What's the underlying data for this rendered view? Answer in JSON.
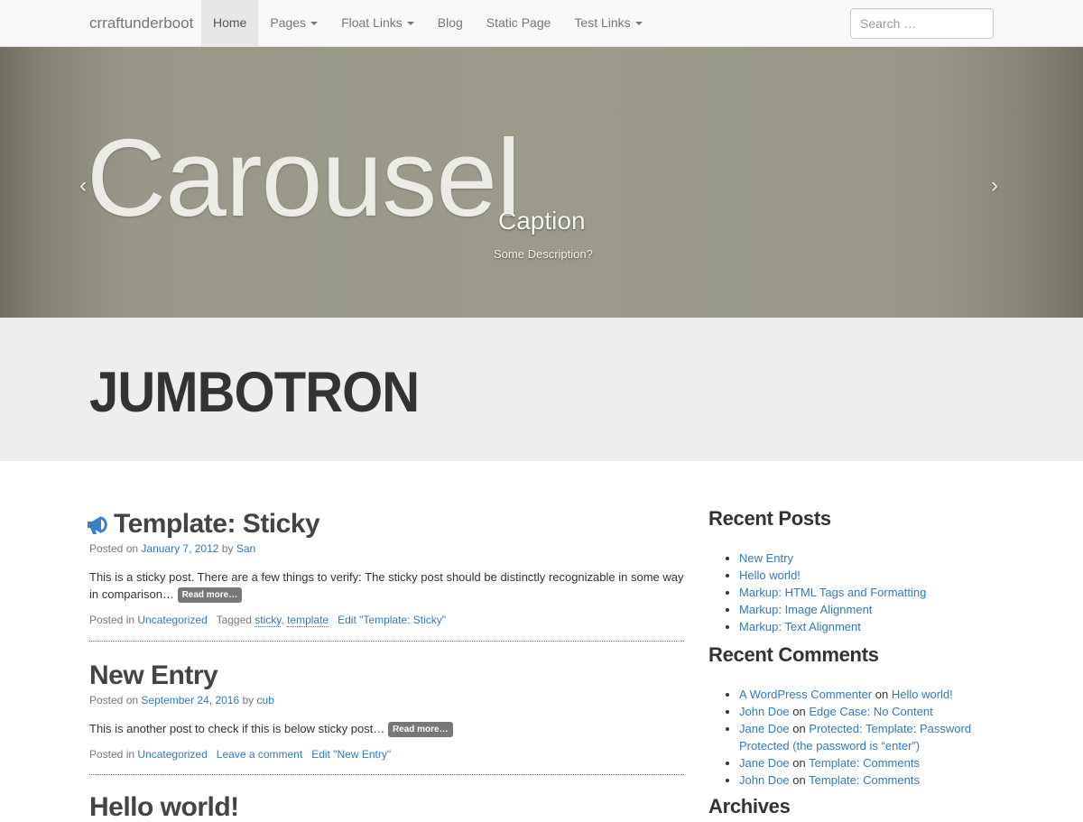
{
  "navbar": {
    "brand": "crraftunderboot",
    "items": [
      {
        "label": "Home"
      },
      {
        "label": "Pages"
      },
      {
        "label": "Float Links"
      },
      {
        "label": "Blog"
      },
      {
        "label": "Static Page"
      },
      {
        "label": "Test Links"
      }
    ],
    "search_placeholder": "Search …"
  },
  "carousel": {
    "title": "Carousel",
    "caption": "Caption",
    "description": "Some Description?",
    "prev_icon": "chevron-left-icon",
    "next_icon": "chevron-right-icon"
  },
  "jumbotron": {
    "title": "JUMBOTRON"
  },
  "posts": [
    {
      "title": "Template: Sticky",
      "icon": "megaphone-icon",
      "posted_on_label": "Posted on",
      "date": "January 7, 2012",
      "by_label": "by",
      "author": "San",
      "excerpt": "This is a sticky post. There are a few things to verify: The sticky post should be distinctly recognizable in some way in comparison…",
      "read_more": "Read more…",
      "posted_in_label": "Posted in",
      "category": "Uncategorized",
      "tagged_label": "Tagged",
      "tags": [
        "sticky",
        "template"
      ],
      "edit": "Edit \"Template: Sticky\""
    },
    {
      "title": "New Entry",
      "posted_on_label": "Posted on",
      "date": "September 24, 2016",
      "by_label": "by",
      "author": "cub",
      "excerpt": "This is another post to check if this is below sticky post…",
      "read_more": "Read more…",
      "posted_in_label": "Posted in",
      "category": "Uncategorized",
      "leave_comment": "Leave a comment",
      "edit": "Edit \"New Entry\""
    },
    {
      "title": "Hello world!"
    }
  ],
  "sidebar": {
    "recent_posts": {
      "title": "Recent Posts",
      "items": [
        "New Entry",
        "Hello world!",
        "Markup: HTML Tags and Formatting",
        "Markup: Image Alignment",
        "Markup: Text Alignment"
      ]
    },
    "recent_comments": {
      "title": "Recent Comments",
      "on_label": "on",
      "items": [
        {
          "author": "A WordPress Commenter",
          "post": "Hello world!"
        },
        {
          "author": "John Doe",
          "post": "Edge Case: No Content"
        },
        {
          "author": "Jane Doe",
          "post": "Protected: Template: Password Protected (the password is “enter”)"
        },
        {
          "author": "Jane Doe",
          "post": "Template: Comments"
        },
        {
          "author": "John Doe",
          "post": "Template: Comments"
        }
      ]
    },
    "archives": {
      "title": "Archives"
    }
  },
  "colors": {
    "link": "#337ab7",
    "navbar_bg": "#f8f8f8",
    "jumbotron_bg": "#eeeeee",
    "readmore_bg": "#777777"
  }
}
